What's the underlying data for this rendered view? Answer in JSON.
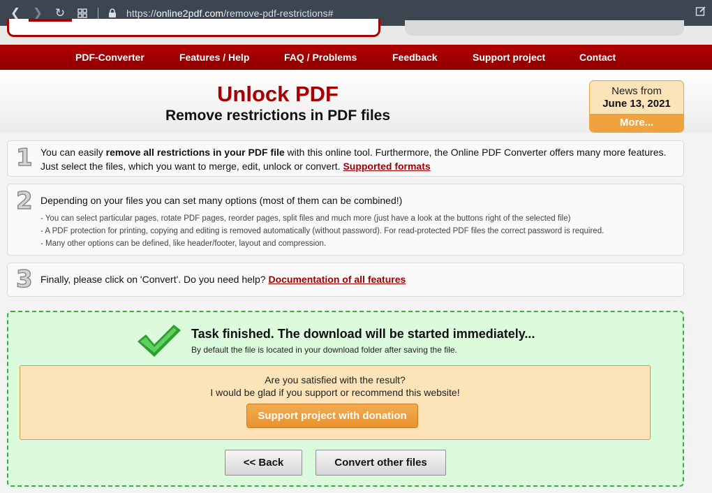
{
  "browser": {
    "url_prefix": "https://",
    "url_domain": "online2pdf.com",
    "url_path": "/remove-pdf-restrictions#"
  },
  "menu": {
    "items": [
      "PDF-Converter",
      "Features / Help",
      "FAQ / Problems",
      "Feedback",
      "Support project",
      "Contact"
    ]
  },
  "header": {
    "title": "Unlock PDF",
    "subtitle": "Remove restrictions in PDF files"
  },
  "news": {
    "line1": "News from",
    "date": "June 13, 2021",
    "more": "More..."
  },
  "steps": {
    "s1": {
      "num": "1",
      "t1": "You can easily ",
      "t1_bold": "remove all restrictions in your PDF file",
      "t1_rest": " with this online tool. Furthermore, the Online PDF Converter offers many more features.",
      "t2": "Just select the files, which you want to merge, edit, unlock or convert. ",
      "link": "Supported formats"
    },
    "s2": {
      "num": "2",
      "t1": "Depending on your files you can set many options (most of them can be combined!)",
      "b1": "- You can select particular pages, rotate PDF pages, reorder pages, split files and much more (just have a look at the buttons right of the selected file)",
      "b2": "- A PDF protection for printing, copying and editing is removed automatically (without password). For read-protected PDF files the correct password is required.",
      "b3": "- Many other options can be defined, like header/footer, layout and compression."
    },
    "s3": {
      "num": "3",
      "t1": "Finally, please click on 'Convert'. Do you need help? ",
      "link": "Documentation of all features"
    }
  },
  "result": {
    "title": "Task finished. The download will be started immediately...",
    "sub": "By default the file is located in your download folder after saving the file.",
    "q1": "Are you satisfied with the result?",
    "q2": "I would be glad if you support or recommend this website!",
    "donate": "Support project with donation",
    "back": "<< Back",
    "convert_other": "Convert other files"
  },
  "colors": {
    "brand_red": "#a80000",
    "success_green": "#35b335",
    "accent_orange": "#f0a23e"
  }
}
